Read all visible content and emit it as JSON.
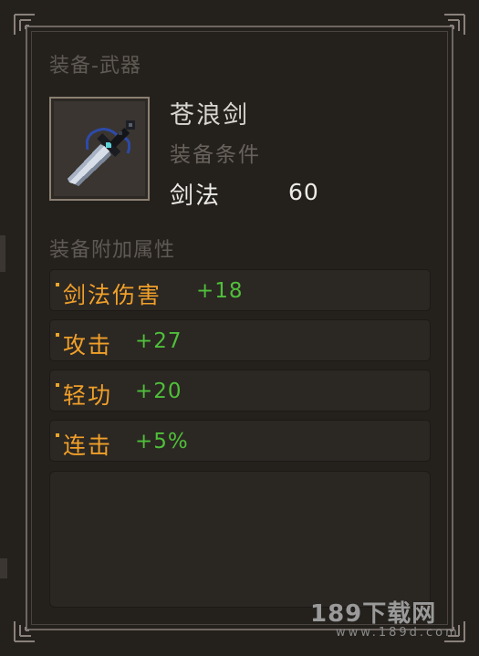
{
  "panel": {
    "category_title": "装备-武器",
    "item_name": "苍浪剑",
    "requirement_label": "装备条件",
    "requirement_skill": "剑法",
    "requirement_value": "60",
    "extra_attrs_title": "装备附加属性",
    "attributes": [
      {
        "name": "剑法伤害",
        "value": "+18"
      },
      {
        "name": "攻击",
        "value": "+27"
      },
      {
        "name": "轻功",
        "value": "+20"
      },
      {
        "name": "连击",
        "value": "+5%"
      }
    ],
    "item_icon": "sword-icon"
  },
  "watermark": {
    "main": "189下载网",
    "sub": "www.189d.com"
  },
  "colors": {
    "attr_name": "#f0a02a",
    "attr_value": "#4fbf3a",
    "frame": "#6e6660"
  }
}
